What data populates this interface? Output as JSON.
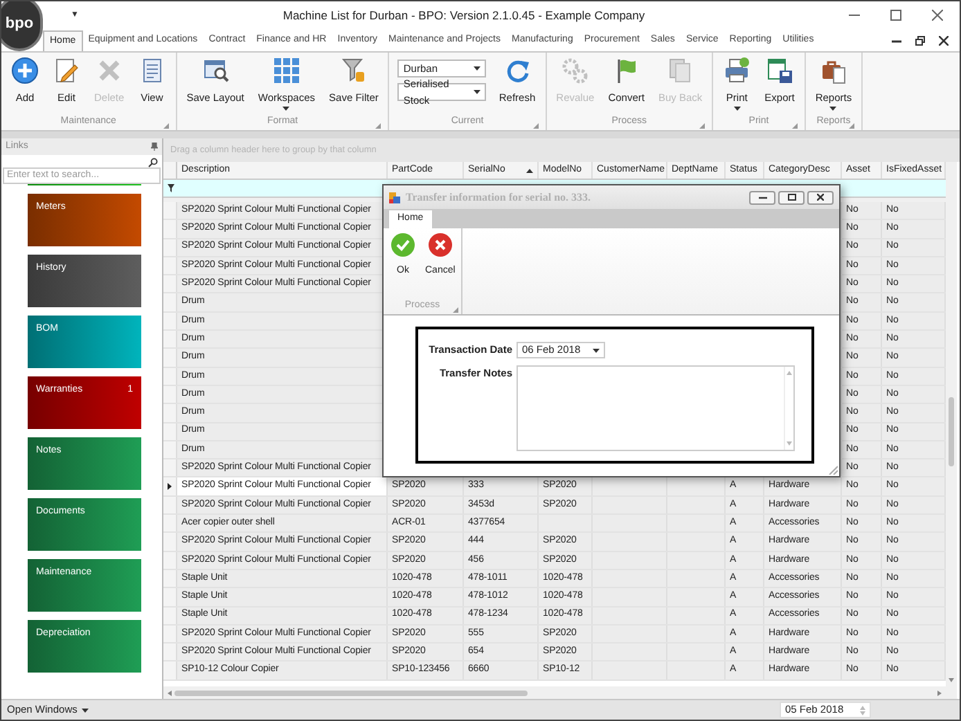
{
  "window": {
    "logo": "bpo",
    "quick_access": "▼",
    "title": "Machine List for Durban - BPO: Version 2.1.0.45 - Example Company"
  },
  "ribbon_tabs": [
    {
      "label": "Home",
      "selected": true
    },
    {
      "label": "Equipment and Locations",
      "selected": false
    },
    {
      "label": "Contract",
      "selected": false
    },
    {
      "label": "Finance and HR",
      "selected": false
    },
    {
      "label": "Inventory",
      "selected": false
    },
    {
      "label": "Maintenance and Projects",
      "selected": false
    },
    {
      "label": "Manufacturing",
      "selected": false
    },
    {
      "label": "Procurement",
      "selected": false
    },
    {
      "label": "Sales",
      "selected": false
    },
    {
      "label": "Service",
      "selected": false
    },
    {
      "label": "Reporting",
      "selected": false
    },
    {
      "label": "Utilities",
      "selected": false
    }
  ],
  "ribbon_groups": [
    {
      "label": "Maintenance",
      "items": [
        {
          "kind": "button",
          "label": "Add",
          "disabled": false
        },
        {
          "kind": "button",
          "label": "Edit",
          "disabled": false
        },
        {
          "kind": "button",
          "label": "Delete",
          "disabled": true
        },
        {
          "kind": "button",
          "label": "View",
          "disabled": false
        }
      ]
    },
    {
      "label": "Format",
      "items": [
        {
          "kind": "button",
          "label": "Save Layout",
          "disabled": false
        },
        {
          "kind": "menu_button",
          "label": "Workspaces",
          "disabled": false
        },
        {
          "kind": "button",
          "label": "Save Filter",
          "disabled": false
        }
      ]
    },
    {
      "label": "Current",
      "items": [
        {
          "kind": "combo",
          "value": "Durban"
        },
        {
          "kind": "combo",
          "value": "Serialised Stock"
        },
        {
          "kind": "button",
          "label": "Refresh",
          "disabled": false
        }
      ]
    },
    {
      "label": "Process",
      "items": [
        {
          "kind": "button",
          "label": "Revalue",
          "disabled": true
        },
        {
          "kind": "button",
          "label": "Convert",
          "disabled": false
        },
        {
          "kind": "button",
          "label": "Buy Back",
          "disabled": true
        }
      ]
    },
    {
      "label": "Print",
      "items": [
        {
          "kind": "menu_button",
          "label": "Print",
          "disabled": false
        },
        {
          "kind": "button",
          "label": "Export",
          "disabled": false
        }
      ]
    },
    {
      "label": "Reports",
      "items": [
        {
          "kind": "menu_button",
          "label": "Reports",
          "disabled": false
        }
      ]
    }
  ],
  "links_panel": {
    "title": "Links",
    "search": {
      "placeholder": "Enter text to search..."
    },
    "tiles": [
      {
        "label": "Meters",
        "color": "#c44a00"
      },
      {
        "label": "History",
        "color": "#5e5e5e"
      },
      {
        "label": "BOM",
        "color": "#00b4bc"
      },
      {
        "label": "Warranties",
        "color": "#c00000",
        "badge": "1"
      },
      {
        "label": "Notes",
        "color": "#1f9e55"
      },
      {
        "label": "Documents",
        "color": "#1f9e55"
      },
      {
        "label": "Maintenance",
        "color": "#1f9e55"
      },
      {
        "label": "Depreciation",
        "color": "#1f9e55"
      }
    ]
  },
  "grid": {
    "group_panel": "Drag a column header here to group by that column",
    "columns": [
      {
        "label": "Description",
        "sorted": false
      },
      {
        "label": "PartCode",
        "sorted": false
      },
      {
        "label": "SerialNo",
        "sorted": true
      },
      {
        "label": "ModelNo",
        "sorted": false
      },
      {
        "label": "CustomerName",
        "sorted": false
      },
      {
        "label": "DeptName",
        "sorted": false
      },
      {
        "label": "Status",
        "sorted": false
      },
      {
        "label": "CategoryDesc",
        "sorted": false
      },
      {
        "label": "Asset",
        "sorted": false
      },
      {
        "label": "IsFixedAsset",
        "sorted": false
      }
    ],
    "rows": [
      {
        "selected": false,
        "description": "SP2020 Sprint Colour Multi Functional Copier",
        "asset": "No",
        "is_fixed_asset": "No"
      },
      {
        "selected": false,
        "description": "SP2020 Sprint Colour Multi Functional Copier",
        "asset": "No",
        "is_fixed_asset": "No"
      },
      {
        "selected": false,
        "description": "SP2020 Sprint Colour Multi Functional Copier",
        "asset": "No",
        "is_fixed_asset": "No"
      },
      {
        "selected": false,
        "description": "SP2020 Sprint Colour Multi Functional Copier",
        "asset": "No",
        "is_fixed_asset": "No"
      },
      {
        "selected": false,
        "description": "SP2020 Sprint Colour Multi Functional Copier",
        "asset": "No",
        "is_fixed_asset": "No"
      },
      {
        "selected": false,
        "description": "Drum",
        "asset": "No",
        "is_fixed_asset": "No"
      },
      {
        "selected": false,
        "description": "Drum",
        "asset": "No",
        "is_fixed_asset": "No"
      },
      {
        "selected": false,
        "description": "Drum",
        "asset": "No",
        "is_fixed_asset": "No"
      },
      {
        "selected": false,
        "description": "Drum",
        "asset": "No",
        "is_fixed_asset": "No"
      },
      {
        "selected": false,
        "description": "Drum",
        "asset": "No",
        "is_fixed_asset": "No"
      },
      {
        "selected": false,
        "description": "Drum",
        "asset": "No",
        "is_fixed_asset": "No"
      },
      {
        "selected": false,
        "description": "Drum",
        "asset": "No",
        "is_fixed_asset": "No"
      },
      {
        "selected": false,
        "description": "Drum",
        "asset": "No",
        "is_fixed_asset": "No"
      },
      {
        "selected": false,
        "description": "Drum",
        "asset": "No",
        "is_fixed_asset": "No"
      },
      {
        "selected": false,
        "description": "SP2020 Sprint Colour Multi Functional Copier",
        "asset": "No",
        "is_fixed_asset": "No"
      },
      {
        "selected": true,
        "description": "SP2020 Sprint Colour Multi Functional Copier",
        "part_code": "SP2020",
        "serial_no": "333",
        "model_no": "SP2020",
        "status": "A",
        "category": "Hardware",
        "asset": "No",
        "is_fixed_asset": "No"
      },
      {
        "selected": false,
        "description": "SP2020 Sprint Colour Multi Functional Copier",
        "part_code": "SP2020",
        "serial_no": "3453d",
        "model_no": "SP2020",
        "status": "A",
        "category": "Hardware",
        "asset": "No",
        "is_fixed_asset": "No"
      },
      {
        "selected": false,
        "description": "Acer copier outer shell",
        "part_code": "ACR-01",
        "serial_no": "4377654",
        "status": "A",
        "category": "Accessories",
        "asset": "No",
        "is_fixed_asset": "No"
      },
      {
        "selected": false,
        "description": "SP2020 Sprint Colour Multi Functional Copier",
        "part_code": "SP2020",
        "serial_no": "444",
        "model_no": "SP2020",
        "status": "A",
        "category": "Hardware",
        "asset": "No",
        "is_fixed_asset": "No"
      },
      {
        "selected": false,
        "description": "SP2020 Sprint Colour Multi Functional Copier",
        "part_code": "SP2020",
        "serial_no": "456",
        "model_no": "SP2020",
        "status": "A",
        "category": "Hardware",
        "asset": "No",
        "is_fixed_asset": "No"
      },
      {
        "selected": false,
        "description": "Staple Unit",
        "part_code": "1020-478",
        "serial_no": "478-1011",
        "model_no": "1020-478",
        "status": "A",
        "category": "Accessories",
        "asset": "No",
        "is_fixed_asset": "No"
      },
      {
        "selected": false,
        "description": "Staple Unit",
        "part_code": "1020-478",
        "serial_no": "478-1012",
        "model_no": "1020-478",
        "status": "A",
        "category": "Accessories",
        "asset": "No",
        "is_fixed_asset": "No"
      },
      {
        "selected": false,
        "description": "Staple Unit",
        "part_code": "1020-478",
        "serial_no": "478-1234",
        "model_no": "1020-478",
        "status": "A",
        "category": "Accessories",
        "asset": "No",
        "is_fixed_asset": "No"
      },
      {
        "selected": false,
        "description": "SP2020 Sprint Colour Multi Functional Copier",
        "part_code": "SP2020",
        "serial_no": "555",
        "model_no": "SP2020",
        "status": "A",
        "category": "Hardware",
        "asset": "No",
        "is_fixed_asset": "No"
      },
      {
        "selected": false,
        "description": "SP2020 Sprint Colour Multi Functional Copier",
        "part_code": "SP2020",
        "serial_no": "654",
        "model_no": "SP2020",
        "status": "A",
        "category": "Hardware",
        "asset": "No",
        "is_fixed_asset": "No"
      },
      {
        "selected": false,
        "description": "SP10-12 Colour Copier",
        "part_code": "SP10-123456",
        "serial_no": "6660",
        "model_no": "SP10-12",
        "status": "A",
        "category": "Hardware",
        "asset": "No",
        "is_fixed_asset": "No"
      }
    ]
  },
  "dialog": {
    "title": "Transfer information for serial no. 333.",
    "tabs": [
      {
        "label": "Home",
        "selected": true
      }
    ],
    "group_label": "Process",
    "buttons": [
      {
        "kind": "ok",
        "label": "Ok"
      },
      {
        "kind": "cancel",
        "label": "Cancel"
      }
    ],
    "fields": [
      {
        "kind": "date",
        "label": "Transaction Date",
        "value": "06 Feb 2018"
      },
      {
        "kind": "notes",
        "label": "Transfer Notes"
      }
    ]
  },
  "status_bar": {
    "open_windows": "Open Windows",
    "date": "05 Feb 2018"
  }
}
